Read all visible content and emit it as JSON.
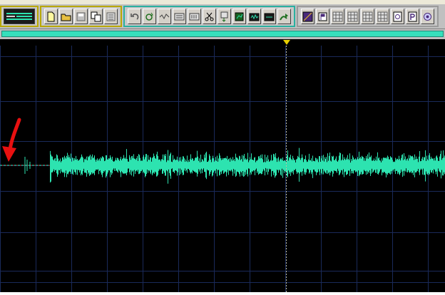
{
  "app": {
    "accent_yellow": "#b9a800",
    "accent_teal": "#2ab0a0",
    "waveform_color": "#2de3b0",
    "grid_color": "#1a2a5a",
    "cursor_color": "#e8d000",
    "annotation_color": "#e81010"
  },
  "toolbar": {
    "groups": [
      {
        "id": "transport",
        "buttons": []
      },
      {
        "id": "file",
        "buttons": [
          "new-file-icon",
          "open-folder-icon",
          "save-icon",
          "save-as-icon",
          "close-file-icon"
        ]
      },
      {
        "id": "edit",
        "buttons": [
          "undo-icon",
          "redo-icon",
          "cut-wave-icon",
          "copy-icon",
          "paste-icon",
          "scissors-icon",
          "paste-mix-icon",
          "paste-new-icon",
          "trim-icon",
          "selection-icon",
          "play-icon"
        ]
      },
      {
        "id": "view",
        "buttons": [
          "diagonal-icon",
          "flag-icon",
          "grid-icon",
          "grid-icon",
          "grid-icon",
          "grid-icon",
          "properties-icon",
          "p-icon",
          "settings-icon"
        ]
      }
    ]
  },
  "transport": {
    "progress_fraction": 1.0
  },
  "waveform": {
    "cursor_position_fraction": 0.645,
    "silence_end_fraction": 0.115,
    "annotation": "red-arrow-icon"
  }
}
